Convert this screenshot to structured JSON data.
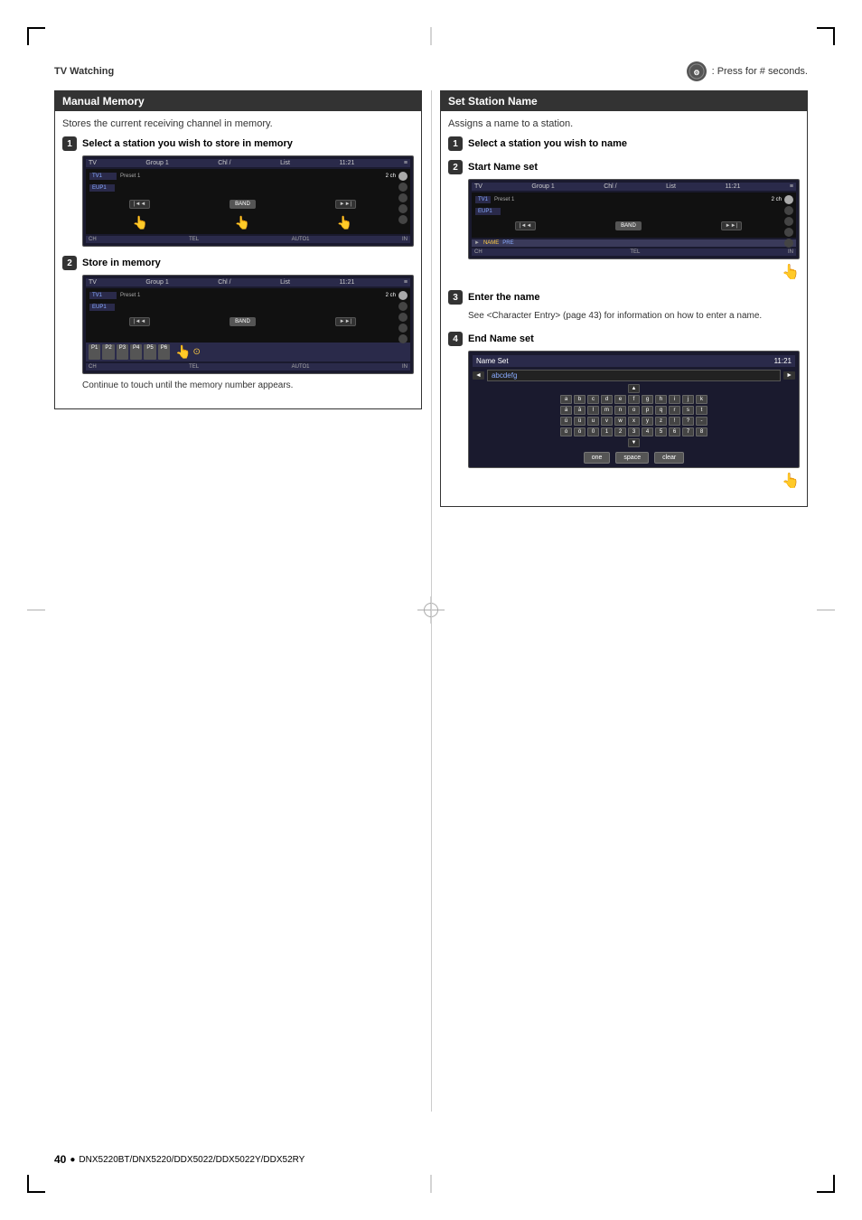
{
  "page": {
    "title": "TV Watching",
    "press_instruction": ": Press for # seconds.",
    "footer_page": "40",
    "footer_bullet": "●",
    "footer_model": "DNX5220BT/DNX5220/DDX5022/DDX5022Y/DDX52RY"
  },
  "manual_memory": {
    "title": "Manual Memory",
    "description": "Stores the current receiving channel in memory.",
    "step1_label": "Select a station you wish to store in memory",
    "step2_label": "Store in memory",
    "note": "Continue to touch until the memory number appears.",
    "tv1": {
      "group": "Group 1",
      "preset": "Preset 1",
      "ch": "2 ch",
      "time": "11:21",
      "channel_bar": "EUP1",
      "band_btn": "BAND",
      "tel": "TEL",
      "auto": "AUTO1"
    },
    "tv2": {
      "group": "Group 1",
      "preset": "Preset 1",
      "ch": "2 ch",
      "time": "11:21",
      "channel_bar": "EUP1",
      "band_btn": "BAND",
      "tel": "TEL",
      "auto": "AUTO1",
      "presets": [
        "P1",
        "P2",
        "P3",
        "P4",
        "P5",
        "P6"
      ]
    }
  },
  "set_station_name": {
    "title": "Set Station Name",
    "description": "Assigns a name to a station.",
    "step1_label": "Select a station you wish to name",
    "step2_label": "Start Name set",
    "step3_label": "Enter the name",
    "step3_desc": "See <Character Entry> (page 43) for information on how to enter a name.",
    "step4_label": "End Name set",
    "tv1": {
      "group": "Group 1",
      "preset": "Preset 1",
      "ch": "2 ch",
      "time": "11:21",
      "channel_bar": "EUP1",
      "band_btn": "BAND",
      "tel": "TEL",
      "name_btn": "NAME",
      "pre_btn": "PRE"
    },
    "name_set": {
      "title": "Name Set",
      "time": "11:21",
      "input_text": "abcdefg",
      "nav_left": "◄",
      "nav_right": "►",
      "nav_up": "▲",
      "nav_down": "▼",
      "keys_row1": [
        "a",
        "b",
        "c",
        "d",
        "e",
        "f",
        "g",
        "h",
        "i",
        "j",
        "k"
      ],
      "keys_row2": [
        "l",
        "m",
        "n",
        "o",
        "p",
        "q",
        "r",
        "s",
        "t",
        "u"
      ],
      "keys_row3": [
        "v",
        "w",
        "x",
        "y",
        "z",
        "!",
        "?",
        "-"
      ],
      "bottom_btns": [
        "one",
        "space",
        "clear"
      ]
    }
  }
}
